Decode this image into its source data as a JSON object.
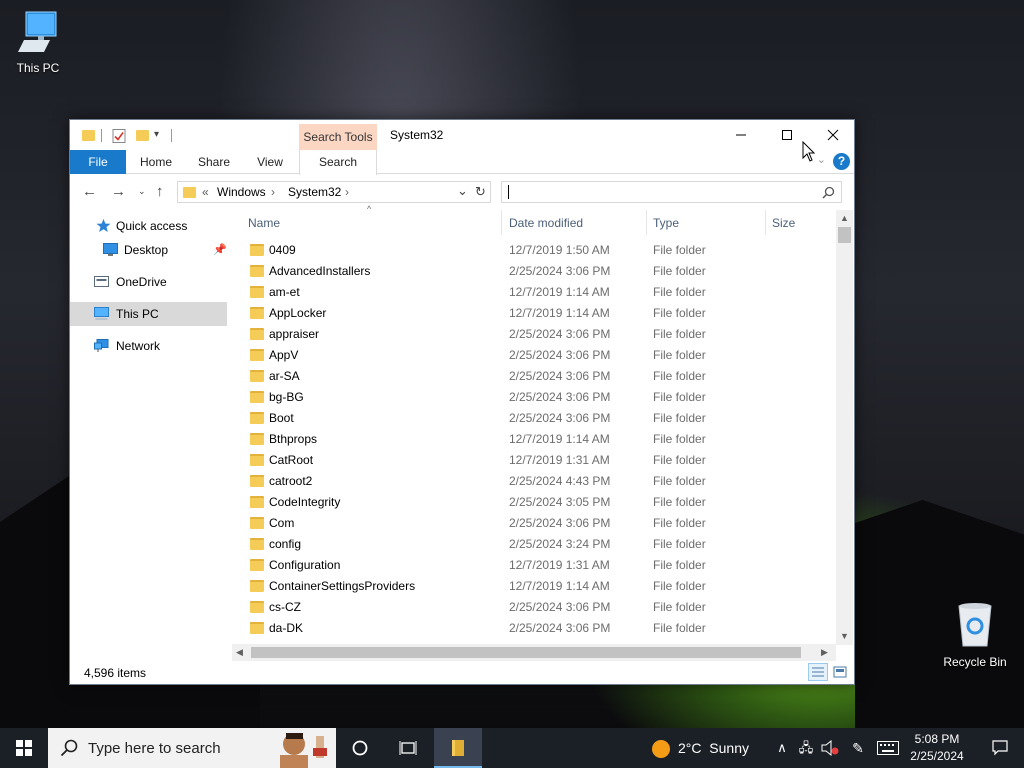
{
  "desktop": {
    "icons": [
      {
        "label": "This PC"
      },
      {
        "label": "Recycle Bin"
      }
    ]
  },
  "window": {
    "title": "System32",
    "contextual_tab_group": "Search Tools",
    "ribbon_tabs": [
      "File",
      "Home",
      "Share",
      "View",
      "Search"
    ],
    "address": {
      "overflow": "«",
      "crumbs": [
        "Windows",
        "System32"
      ]
    },
    "search": {
      "placeholder": "",
      "value": ""
    },
    "nav_pane": [
      {
        "label": "Quick access",
        "icon": "star-icon"
      },
      {
        "label": "Desktop",
        "icon": "desktop-icon"
      },
      {
        "label": "OneDrive",
        "icon": "onedrive-icon"
      },
      {
        "label": "This PC",
        "icon": "pc-icon"
      },
      {
        "label": "Network",
        "icon": "network-icon"
      }
    ],
    "columns": [
      "Name",
      "Date modified",
      "Type",
      "Size"
    ],
    "rows": [
      {
        "name": "0409",
        "date": "12/7/2019 1:50 AM",
        "type": "File folder"
      },
      {
        "name": "AdvancedInstallers",
        "date": "2/25/2024 3:06 PM",
        "type": "File folder"
      },
      {
        "name": "am-et",
        "date": "12/7/2019 1:14 AM",
        "type": "File folder"
      },
      {
        "name": "AppLocker",
        "date": "12/7/2019 1:14 AM",
        "type": "File folder"
      },
      {
        "name": "appraiser",
        "date": "2/25/2024 3:06 PM",
        "type": "File folder"
      },
      {
        "name": "AppV",
        "date": "2/25/2024 3:06 PM",
        "type": "File folder"
      },
      {
        "name": "ar-SA",
        "date": "2/25/2024 3:06 PM",
        "type": "File folder"
      },
      {
        "name": "bg-BG",
        "date": "2/25/2024 3:06 PM",
        "type": "File folder"
      },
      {
        "name": "Boot",
        "date": "2/25/2024 3:06 PM",
        "type": "File folder"
      },
      {
        "name": "Bthprops",
        "date": "12/7/2019 1:14 AM",
        "type": "File folder"
      },
      {
        "name": "CatRoot",
        "date": "12/7/2019 1:31 AM",
        "type": "File folder"
      },
      {
        "name": "catroot2",
        "date": "2/25/2024 4:43 PM",
        "type": "File folder"
      },
      {
        "name": "CodeIntegrity",
        "date": "2/25/2024 3:05 PM",
        "type": "File folder"
      },
      {
        "name": "Com",
        "date": "2/25/2024 3:06 PM",
        "type": "File folder"
      },
      {
        "name": "config",
        "date": "2/25/2024 3:24 PM",
        "type": "File folder"
      },
      {
        "name": "Configuration",
        "date": "12/7/2019 1:31 AM",
        "type": "File folder"
      },
      {
        "name": "ContainerSettingsProviders",
        "date": "12/7/2019 1:14 AM",
        "type": "File folder"
      },
      {
        "name": "cs-CZ",
        "date": "2/25/2024 3:06 PM",
        "type": "File folder"
      },
      {
        "name": "da-DK",
        "date": "2/25/2024 3:06 PM",
        "type": "File folder"
      }
    ],
    "status": {
      "item_count": "4,596 items"
    }
  },
  "taskbar": {
    "search_placeholder": "Type here to search",
    "weather": {
      "temp": "2°C",
      "condition": "Sunny"
    },
    "clock": {
      "time": "5:08 PM",
      "date": "2/25/2024"
    }
  },
  "colors": {
    "accent": "#1979ca",
    "folder": "#f5cc57",
    "search_tools": "#fbd7c3",
    "taskbar": "#1b1f26"
  }
}
